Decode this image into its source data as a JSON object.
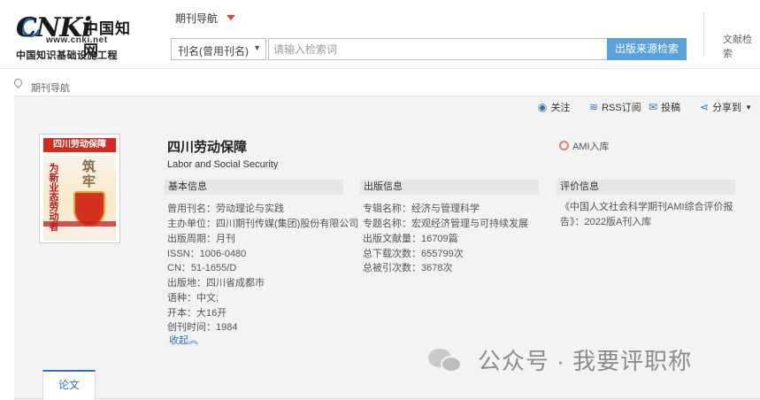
{
  "header": {
    "logo_text": "CNKi",
    "logo_cn": "中国知网",
    "logo_url": "www.cnki.net",
    "logo_slogan": "中国知识基础设施工程",
    "nav_title": "期刊导航",
    "search_type": "刊名(曾用刊名)",
    "search_placeholder": "请输入检索词",
    "search_button": "出版来源检索",
    "doc_search": "文献检索"
  },
  "breadcrumb": {
    "label": "期刊导航"
  },
  "actions": {
    "follow": "关注",
    "rss": "RSS订阅",
    "submit": "投稿",
    "share": "分享到"
  },
  "journal": {
    "title_cn": "四川劳动保障",
    "title_en": "Labor and Social Security",
    "ami": "AMI入库",
    "cover_title": "四川劳动保障",
    "cover_big": "筑牢",
    "cover_sub": "为新业态劳动者"
  },
  "sections": {
    "basic": "基本信息",
    "publish": "出版信息",
    "evaluation": "评价信息"
  },
  "basic_info": [
    {
      "k": "曾用刊名：",
      "v": "劳动理论与实践"
    },
    {
      "k": "主办单位：",
      "v": "四川期刊传媒(集团)股份有限公司"
    },
    {
      "k": "出版周期：",
      "v": "月刊"
    },
    {
      "k": "ISSN：",
      "v": "1006-0480"
    },
    {
      "k": "CN：",
      "v": "51-1655/D"
    },
    {
      "k": "出版地：",
      "v": "四川省成都市"
    },
    {
      "k": "语种：",
      "v": "中文;"
    },
    {
      "k": "开本：",
      "v": "大16开"
    },
    {
      "k": "创刊时间：",
      "v": "1984"
    }
  ],
  "publish_info": [
    {
      "k": "专辑名称：",
      "v": "经济与管理科学"
    },
    {
      "k": "专题名称：",
      "v": "宏观经济管理与可持续发展"
    },
    {
      "k": "出版文献量：",
      "v": "16709篇"
    },
    {
      "k": "总下载次数：",
      "v": "655799次"
    },
    {
      "k": "总被引次数：",
      "v": "3678次"
    }
  ],
  "evaluation_info": "《中国人文社会科学期刊AMI综合评价报告》：2022版A刊入库",
  "collapse_label": "收起",
  "watermark": "公众号 · 我要评职称",
  "tabs": {
    "papers": "论文"
  },
  "icons": {
    "nav_caret": "caret-down-icon",
    "location": "location-pin-icon",
    "follow": "eye-icon",
    "rss": "rss-icon",
    "submit": "mail-icon",
    "share": "share-icon",
    "ami": "medal-icon",
    "wechat": "wechat-icon"
  },
  "colors": {
    "accent": "#5aa0dc",
    "link": "#2f6fb5",
    "caret": "#e0463a",
    "panel": "#f3f3f3"
  }
}
